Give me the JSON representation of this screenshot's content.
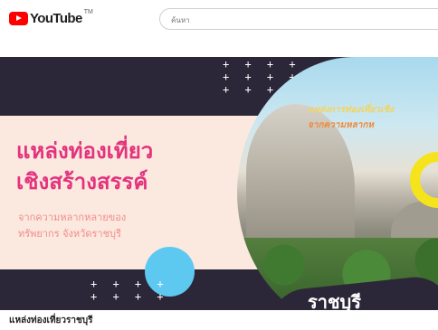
{
  "header": {
    "logo_text": "YouTube",
    "logo_tm": "TM",
    "search_placeholder": "ค้นหา"
  },
  "banner": {
    "plus_top": "+ + + +\n+ + + +\n+ + + +",
    "plus_bottom": "+ + + +\n+ + + +",
    "title_line1": "แหล่งท่องเที่ยว",
    "title_line2": "เชิงสร้างสรรค์",
    "subtitle_line1": "จากความหลากหลายของ",
    "subtitle_line2": "ทรัพยากร จังหวัดราชบุรี",
    "photo_text_line1": "แหล่งการท่องเที่ยวเชิง",
    "photo_text_line2": "จากความหลากห",
    "blob_text": "ราชบุรี"
  },
  "video": {
    "title": "แหล่งท่องเที่ยวราชบุรี"
  },
  "colors": {
    "youtube_red": "#ff0000",
    "banner_dark": "#2c2738",
    "banner_cream": "#fbe9df",
    "title_pink": "#e4327d",
    "subtitle_coral": "#f28c8c",
    "accent_blue": "#5ec9f0",
    "accent_yellow": "#f5e31c"
  }
}
